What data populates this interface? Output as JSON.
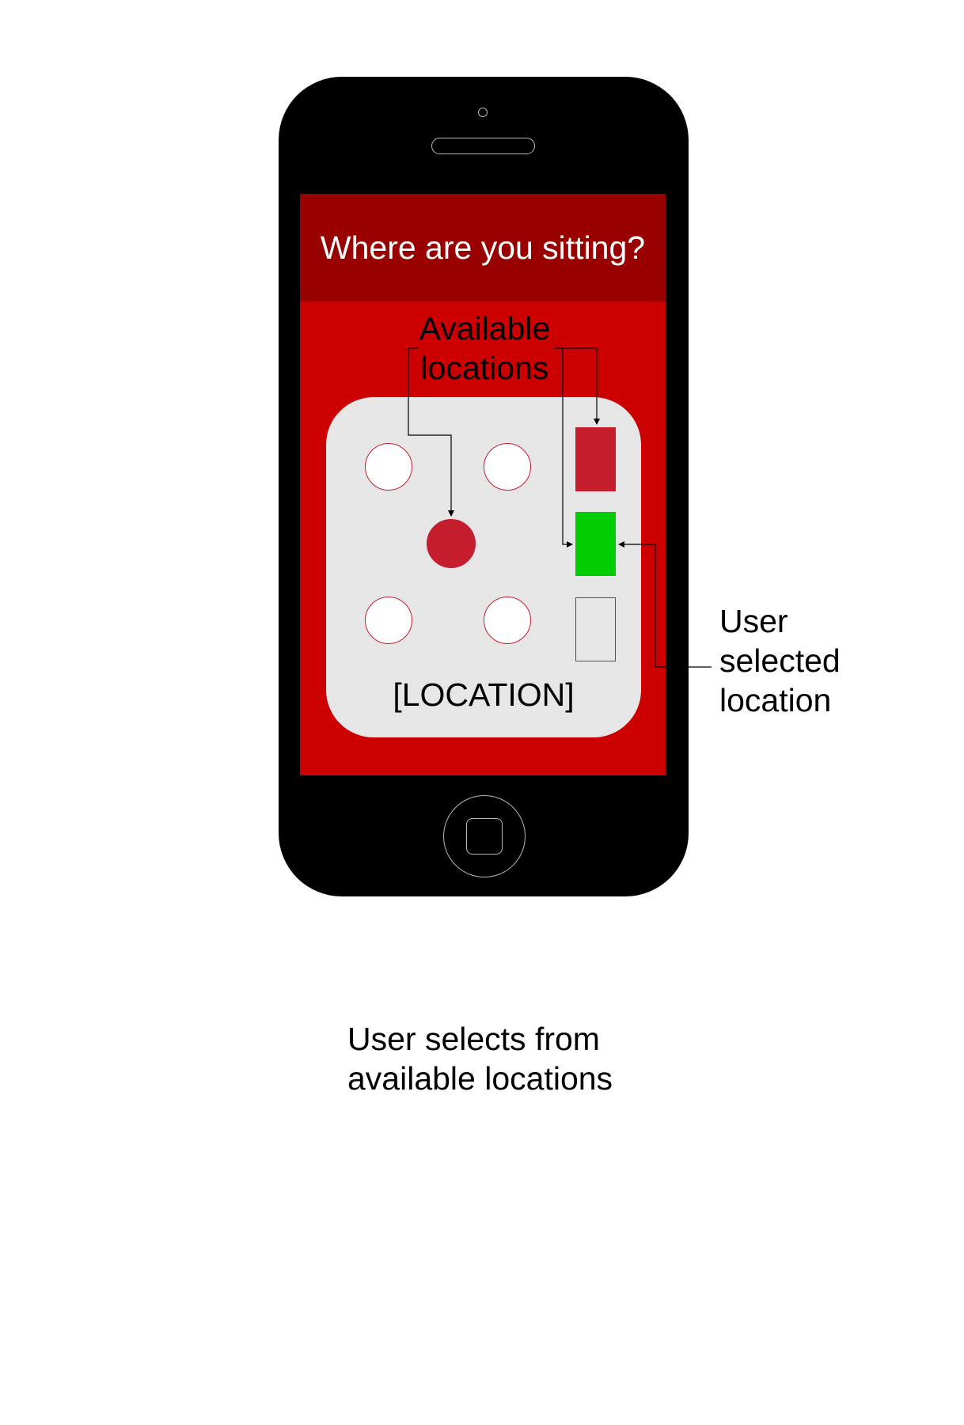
{
  "screen": {
    "header_title": "Where are you sitting?",
    "location_placeholder": "[LOCATION]"
  },
  "annotations": {
    "available_locations_line1": "Available",
    "available_locations_line2": "locations",
    "user_selected_line1": "User",
    "user_selected_line2": "selected",
    "user_selected_line3": "location"
  },
  "caption": {
    "line1": "User selects from",
    "line2": "available locations"
  },
  "seats": [
    {
      "id": "seat-1",
      "state": "available"
    },
    {
      "id": "seat-2",
      "state": "available"
    },
    {
      "id": "seat-3",
      "state": "taken"
    },
    {
      "id": "seat-4",
      "state": "available"
    },
    {
      "id": "seat-5",
      "state": "available"
    }
  ],
  "desks": [
    {
      "id": "desk-1",
      "state": "taken"
    },
    {
      "id": "desk-2",
      "state": "selected"
    },
    {
      "id": "desk-3",
      "state": "available"
    }
  ],
  "colors": {
    "header": "#990000",
    "screen": "#cc0000",
    "panel": "#e6e6e6",
    "taken": "#c41e2e",
    "selected": "#00cc00"
  }
}
